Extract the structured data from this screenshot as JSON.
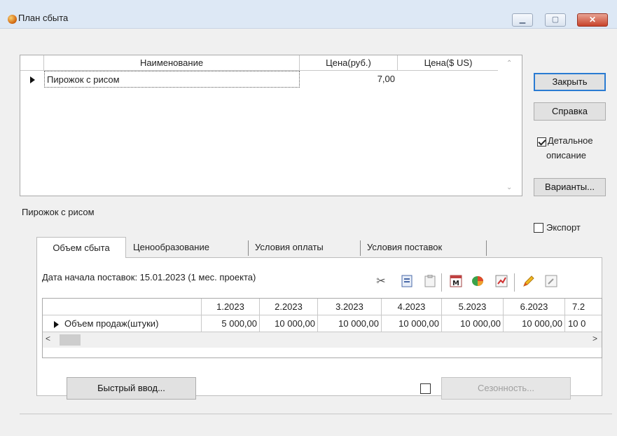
{
  "window": {
    "title": "План сбыта",
    "min_icon": "minimize-icon",
    "max_icon": "maximize-icon",
    "close_icon": "close-icon"
  },
  "products_grid": {
    "columns": [
      "Наименование",
      "Цена(руб.)",
      "Цена($ US)"
    ],
    "rows": [
      {
        "name": "Пирожок с рисом",
        "price_rub": "7,00",
        "price_usd": ""
      }
    ]
  },
  "buttons": {
    "close": "Закрыть",
    "help": "Справка",
    "variants": "Варианты..."
  },
  "detail_checkbox": {
    "label_line1": "Детальное",
    "label_line2": "описание",
    "checked": true
  },
  "export_checkbox": {
    "label": "Экспорт",
    "checked": false
  },
  "selected_product": "Пирожок с рисом",
  "tabs": [
    "Объем сбыта",
    "Ценообразование",
    "Условия оплаты",
    "Условия поставок"
  ],
  "active_tab": 0,
  "start_date": "Дата начала поставок:  15.01.2023 (1 мес. проекта)",
  "toolbar_icons": [
    "cut-icon",
    "copy-icon",
    "paste-icon",
    "memo-icon",
    "chart-icon",
    "calc-icon",
    "pencil-icon",
    "table-icon"
  ],
  "sales_grid": {
    "columns": [
      "1.2023",
      "2.2023",
      "3.2023",
      "4.2023",
      "5.2023",
      "6.2023",
      "7.2"
    ],
    "row_label": "Объем продаж(штуки)",
    "values": [
      "5 000,00",
      "10 000,00",
      "10 000,00",
      "10 000,00",
      "10 000,00",
      "10 000,00",
      "10 0"
    ]
  },
  "quick_input": "Быстрый ввод...",
  "seasonality": {
    "label": "Сезонность...",
    "checked": false
  }
}
